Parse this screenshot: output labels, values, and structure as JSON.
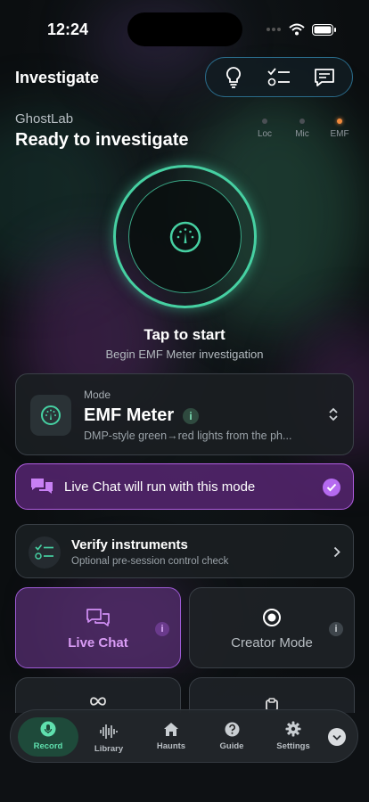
{
  "status": {
    "time": "12:24"
  },
  "header": {
    "title": "Investigate"
  },
  "toolbar": {
    "icons": [
      "lightbulb-icon",
      "checklist-icon",
      "chat-icon"
    ]
  },
  "session": {
    "app_name": "GhostLab",
    "status": "Ready to investigate"
  },
  "sensors": [
    {
      "label": "Loc",
      "active": false
    },
    {
      "label": "Mic",
      "active": false
    },
    {
      "label": "EMF",
      "active": true,
      "color": "#f08a3c"
    }
  ],
  "start": {
    "title": "Tap to start",
    "subtitle": "Begin EMF Meter investigation"
  },
  "mode": {
    "label": "Mode",
    "name": "EMF Meter",
    "info": "i",
    "description": "DMP-style green→red lights from the ph..."
  },
  "live_chat_row": {
    "label": "Live Chat will run with this mode",
    "checked": true
  },
  "verify": {
    "title": "Verify instruments",
    "subtitle": "Optional pre-session control check"
  },
  "buttons": {
    "live_chat": {
      "label": "Live Chat",
      "info": "i"
    },
    "creator_mode": {
      "label": "Creator Mode",
      "info": "i"
    }
  },
  "tabs": [
    {
      "label": "Record",
      "icon": "microphone-icon",
      "active": true
    },
    {
      "label": "Library",
      "icon": "waveform-icon",
      "active": false
    },
    {
      "label": "Haunts",
      "icon": "house-icon",
      "active": false
    },
    {
      "label": "Guide",
      "icon": "question-icon",
      "active": false
    },
    {
      "label": "Settings",
      "icon": "gear-icon",
      "active": false
    }
  ],
  "colors": {
    "accent_green": "#46d0a2",
    "accent_purple": "#b56af0",
    "emf_orange": "#f08a3c"
  }
}
